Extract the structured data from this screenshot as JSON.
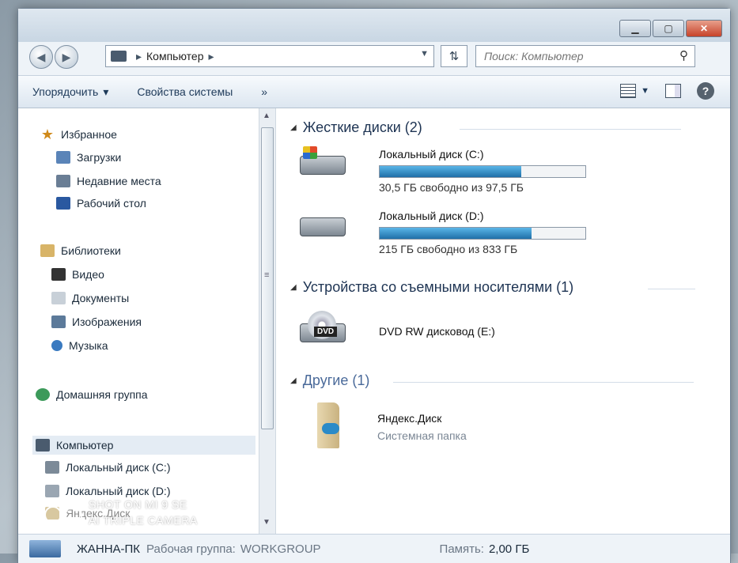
{
  "address": {
    "location": "Компьютер",
    "separator": "▸"
  },
  "search": {
    "placeholder": "Поиск: Компьютер"
  },
  "toolbar": {
    "organize_label": "Упорядочить",
    "system_props_label": "Свойства системы",
    "more_label": "»"
  },
  "nav": {
    "favorites_header": "Избранное",
    "favorites": [
      "Загрузки",
      "Недавние места",
      "Рабочий стол"
    ],
    "libraries_header": "Библиотеки",
    "libraries": [
      "Видео",
      "Документы",
      "Изображения",
      "Музыка"
    ],
    "homegroup": "Домашняя группа",
    "computer_header": "Компьютер",
    "computer_items": [
      "Локальный диск (C:)",
      "Локальный диск (D:)",
      "Яндекс.Диск"
    ]
  },
  "groups": {
    "hard_disks": "Жесткие диски (2)",
    "removable": "Устройства со съемными носителями (1)",
    "other": "Другие (1)"
  },
  "drives": [
    {
      "name": "Локальный диск (C:)",
      "free_text": "30,5 ГБ свободно из 97,5 ГБ",
      "used_fraction": 0.69
    },
    {
      "name": "Локальный диск (D:)",
      "free_text": "215 ГБ свободно из 833 ГБ",
      "used_fraction": 0.74
    }
  ],
  "dvd": {
    "name": "DVD RW дисковод (E:)",
    "badge": "DVD"
  },
  "other_item": {
    "name": "Яндекс.Диск",
    "type": "Системная папка"
  },
  "status": {
    "pc_name": "ЖАННА-ПК",
    "workgroup_label": "Рабочая группа:",
    "workgroup_value": "WORKGROUP",
    "memory_label": "Память:",
    "memory_value": "2,00 ГБ"
  },
  "watermark": {
    "line1": "SHOT ON MI 9 SE",
    "line2": "AI TRIPLE CAMERA"
  }
}
